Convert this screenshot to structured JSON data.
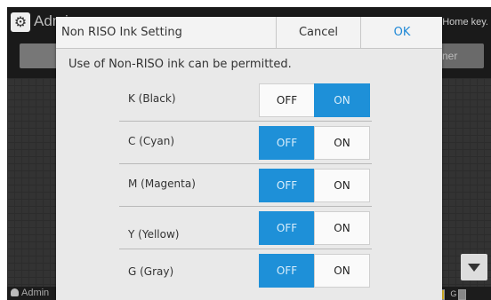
{
  "background": {
    "title": "Admin",
    "hint": "Home key.",
    "right_button": "ner",
    "status": {
      "user": "Admin",
      "state": "Idle",
      "ink": [
        "K",
        "C",
        "M",
        "Y",
        "G"
      ]
    }
  },
  "dialog": {
    "title": "Non RISO Ink Setting",
    "cancel_label": "Cancel",
    "ok_label": "OK",
    "description": "Use of Non-RISO ink can be permitted.",
    "rows": [
      {
        "label": "K (Black)",
        "off_label": "OFF",
        "on_label": "ON",
        "selected": "ON"
      },
      {
        "label": "C (Cyan)",
        "off_label": "OFF",
        "on_label": "ON",
        "selected": "OFF"
      },
      {
        "label": "M (Magenta)",
        "off_label": "OFF",
        "on_label": "ON",
        "selected": "OFF"
      },
      {
        "label": "Y (Yellow)",
        "off_label": "OFF",
        "on_label": "ON",
        "selected": "OFF"
      },
      {
        "label": "G (Gray)",
        "off_label": "OFF",
        "on_label": "ON",
        "selected": "OFF"
      }
    ]
  },
  "colors": {
    "accent": "#1e90d8",
    "ok_text": "#1e88d6",
    "dialog_bg": "#e9e9e9"
  },
  "icons": [
    "gear-icon",
    "user-icon",
    "ink-drop-icon",
    "scroll-down-icon"
  ]
}
